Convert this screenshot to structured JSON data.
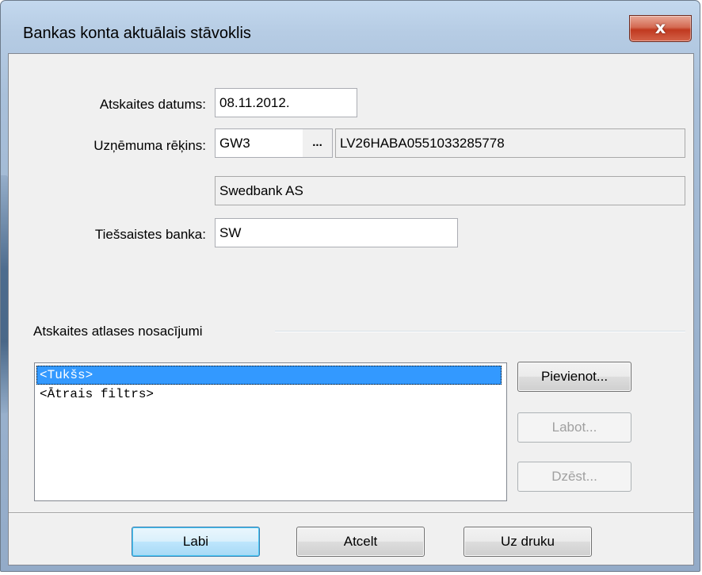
{
  "window": {
    "title": "Bankas konta aktuālais stāvoklis",
    "close_label": "x"
  },
  "form": {
    "report_date": {
      "label": "Atskaites datums:",
      "value": "08.11.2012."
    },
    "company_account": {
      "label": "Uzņēmuma rēķins:",
      "code": "GW3",
      "lookup_label": "...",
      "iban": "LV26HABA0551033285778",
      "bank_name": "Swedbank AS"
    },
    "online_bank": {
      "label": "Tiešsaistes banka:",
      "value": "SW"
    }
  },
  "criteria": {
    "group_label": "Atskaites atlases nosacījumi",
    "items": [
      {
        "label": "<Tukšs>",
        "selected": true
      },
      {
        "label": "<Ātrais filtrs>",
        "selected": false
      }
    ],
    "add_label": "Pievienot...",
    "edit_label": "Labot...",
    "delete_label": "Dzēst..."
  },
  "footer": {
    "ok_label": "Labi",
    "cancel_label": "Atcelt",
    "print_label": "Uz druku"
  }
}
